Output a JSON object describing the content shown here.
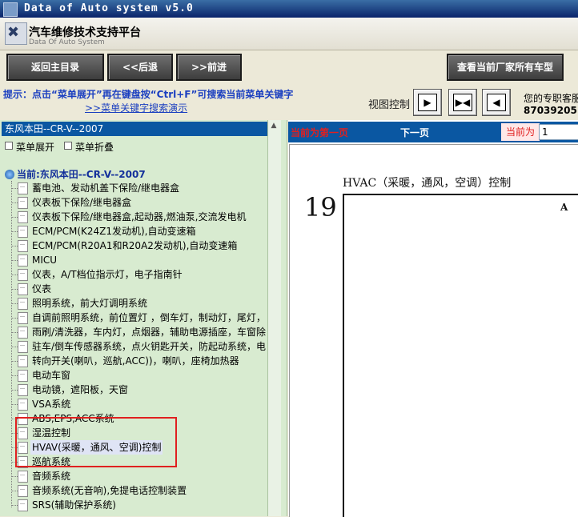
{
  "window": {
    "title": "Data of Auto system v5.0"
  },
  "header": {
    "app_title": "汽车维修技术支持平台",
    "app_subtitle": "Data Of Auto System"
  },
  "toolbar": {
    "home_label": "返回主目录",
    "back_label": "<<后退",
    "forward_label": ">>前进",
    "all_models_label": "查看当前厂家所有车型"
  },
  "hint": {
    "line1": "提示：点击“菜单展开”再在键盘按“Ctrl+F”可搜索当前菜单关键字",
    "link": ">>菜单关键字搜索演示"
  },
  "view_control": {
    "label": "视图控制"
  },
  "customer": {
    "line1": "您的专职客服",
    "line2": "87039205"
  },
  "sidebar": {
    "vehicle": "东风本田--CR-V--2007",
    "expand_label": "菜单展开",
    "collapse_label": "菜单折叠",
    "current_label": "当前:东风本田--CR-V--2007",
    "items": [
      "蓄电池、发动机盖下保险/继电器盒",
      "仪表板下保险/继电器盒",
      "仪表板下保险/继电器盒,起动器,燃油泵,交流发电机",
      "ECM/PCM(K24Z1发动机),自动变速箱",
      "ECM/PCM(R20A1和R20A2发动机),自动变速箱",
      "MICU",
      "仪表，A/T档位指示灯，电子指南针",
      "仪表",
      "照明系统，前大灯调明系统",
      "自调前照明系统，前位置灯 ，倒车灯，制动灯，尾灯，",
      "雨刷/清洗器，车内灯，点烟器，辅助电源插座，车窗除",
      "驻车/倒车传感器系统，点火钥匙开关，防起动系统，电",
      "转向开关(喇叭，巡航,ACC))，喇叭，座椅加热器",
      "电动车窗",
      "电动镜，遮阳板，天窗",
      "VSA系统",
      "ABS,EPS,ACC系统",
      "湿温控制",
      "HVAV(采暖，通风、空调)控制",
      "巡航系统",
      "音频系统",
      "音频系统(无音响),免提电话控制装置",
      "SRS(辅助保护系统)"
    ],
    "selected_index": 18
  },
  "pager": {
    "first_page_label": "当前为第一页",
    "next_label": "下一页",
    "current_label": "当前为",
    "current_value": "1"
  },
  "document": {
    "page_number": "19",
    "title": "HVAC（采暖，通风，空调）控制",
    "corner_letter": "A"
  },
  "colors": {
    "accent": "#0a57a2",
    "sidebar_bg": "#d8ebd0",
    "highlight": "#e02020",
    "hint_text": "#1b3fc0"
  },
  "icons": [
    "app-logo-icon",
    "globe-icon",
    "document-icon",
    "arrow-right-icon",
    "arrows-inward-icon",
    "arrow-left-icon"
  ]
}
